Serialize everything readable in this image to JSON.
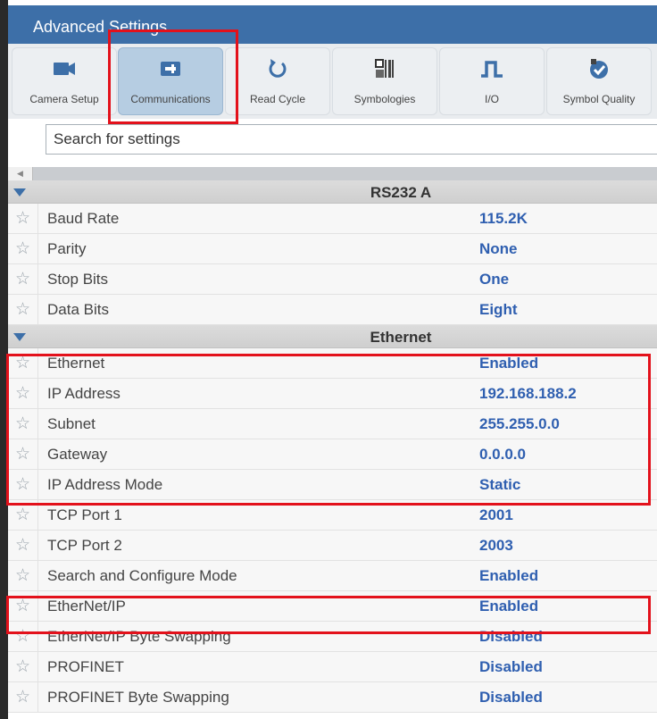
{
  "header": {
    "title": "Advanced Settings"
  },
  "toolbar": {
    "items": [
      {
        "label": "Camera Setup",
        "icon": "camera-icon"
      },
      {
        "label": "Communications",
        "icon": "plug-icon"
      },
      {
        "label": "Read Cycle",
        "icon": "refresh-icon"
      },
      {
        "label": "Symbologies",
        "icon": "barcode-icon"
      },
      {
        "label": "I/O",
        "icon": "pulse-icon"
      },
      {
        "label": "Symbol Quality",
        "icon": "quality-badge-icon"
      }
    ],
    "active": "Communications"
  },
  "search": {
    "placeholder": "Search for settings"
  },
  "groups": [
    {
      "name": "RS232 A",
      "rows": [
        {
          "name": "Baud Rate",
          "value": "115.2K"
        },
        {
          "name": "Parity",
          "value": "None"
        },
        {
          "name": "Stop Bits",
          "value": "One"
        },
        {
          "name": "Data Bits",
          "value": "Eight"
        }
      ]
    },
    {
      "name": "Ethernet",
      "rows": [
        {
          "name": "Ethernet",
          "value": "Enabled"
        },
        {
          "name": "IP Address",
          "value": "192.168.188.2"
        },
        {
          "name": "Subnet",
          "value": "255.255.0.0"
        },
        {
          "name": "Gateway",
          "value": "0.0.0.0"
        },
        {
          "name": "IP Address Mode",
          "value": "Static"
        },
        {
          "name": "TCP Port 1",
          "value": "2001"
        },
        {
          "name": "TCP Port 2",
          "value": "2003"
        },
        {
          "name": "Search and Configure Mode",
          "value": "Enabled"
        },
        {
          "name": "EtherNet/IP",
          "value": "Enabled"
        },
        {
          "name": "EtherNet/IP Byte Swapping",
          "value": "Disabled"
        },
        {
          "name": "PROFINET",
          "value": "Disabled"
        },
        {
          "name": "PROFINET Byte Swapping",
          "value": "Disabled"
        }
      ]
    }
  ],
  "colors": {
    "header": "#3d6fa8",
    "value_text": "#2f5fb0",
    "highlight": "#e3111b",
    "active_tool": "#b6cde2"
  }
}
